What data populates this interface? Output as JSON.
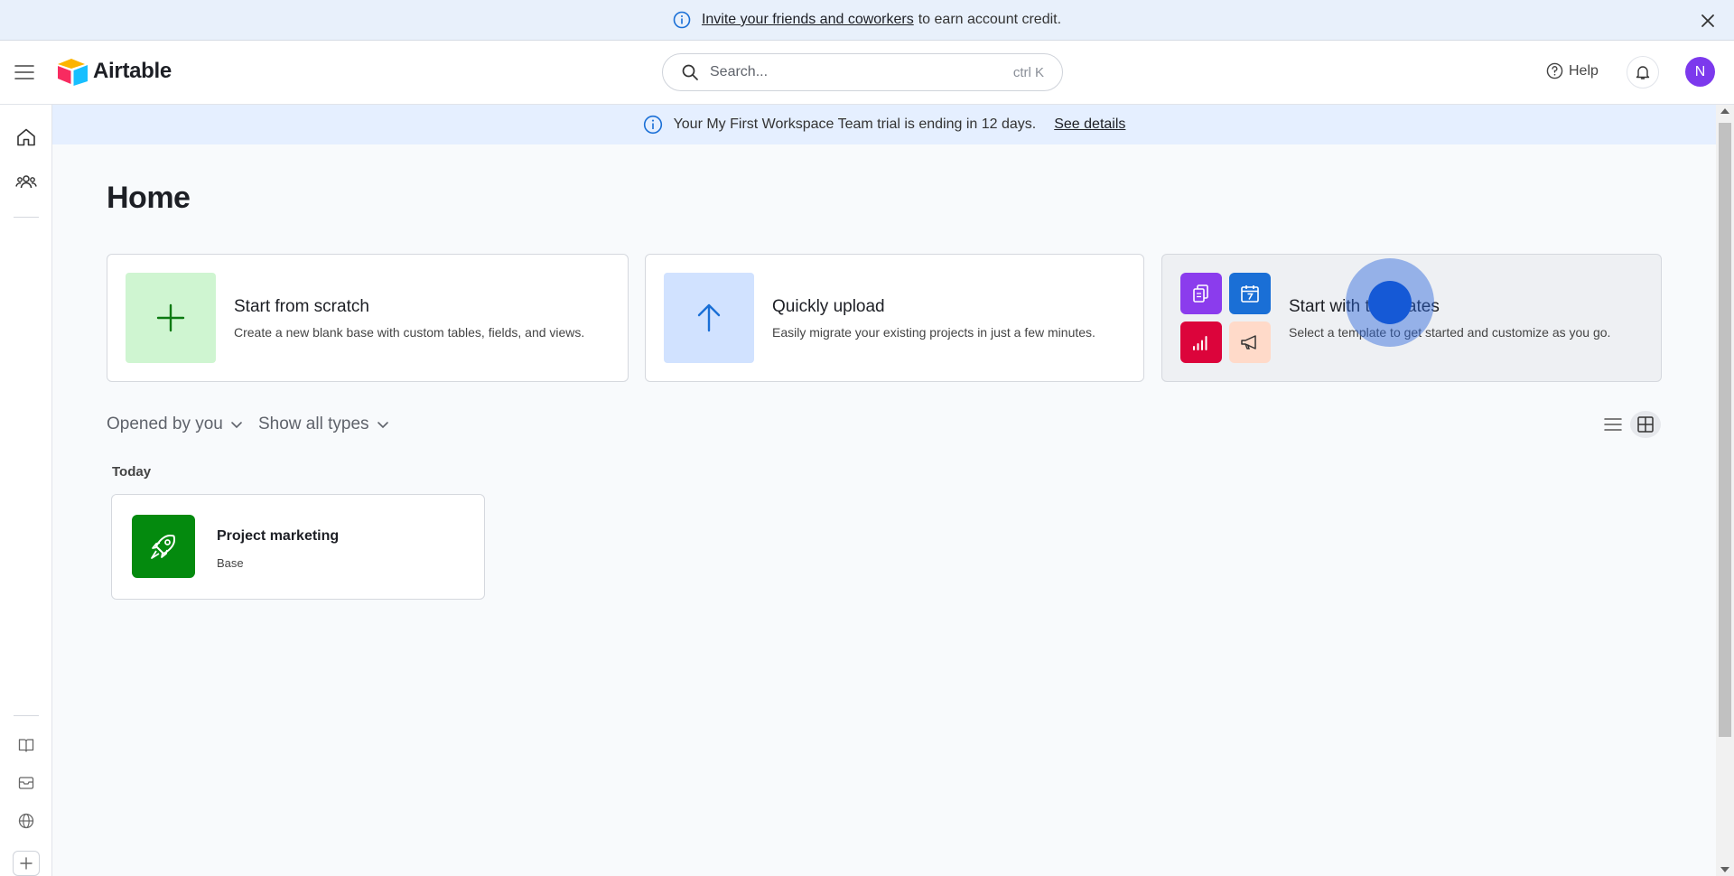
{
  "promo": {
    "link_text": "Invite your friends and coworkers",
    "rest_text": "to earn account credit."
  },
  "header": {
    "logo_text": "Airtable",
    "search_placeholder": "Search...",
    "search_shortcut": "ctrl K",
    "help_label": "Help",
    "avatar_initial": "N",
    "avatar_color": "#7c39ed"
  },
  "trial": {
    "message": "Your My First Workspace Team trial is ending in 12 days.",
    "link": "See details"
  },
  "main": {
    "title": "Home",
    "start_cards": [
      {
        "title": "Start from scratch",
        "desc": "Create a new blank base with custom tables, fields, and views.",
        "icon": "plus-icon",
        "color": "#cff5d1"
      },
      {
        "title": "Quickly upload",
        "desc": "Easily migrate your existing projects in just a few minutes.",
        "icon": "arrow-up-icon",
        "color": "#d1e2ff"
      },
      {
        "title": "Start with templates",
        "desc": "Select a template to get started and customize as you go.",
        "icon": "template-grid-icon",
        "color": "#eef0f3"
      }
    ],
    "filters": {
      "opened_by": "Opened by you",
      "types": "Show all types"
    },
    "section_today": "Today",
    "bases": [
      {
        "name": "Project marketing",
        "type": "Base",
        "icon": "rocket-icon",
        "color": "#048a0e"
      }
    ]
  }
}
